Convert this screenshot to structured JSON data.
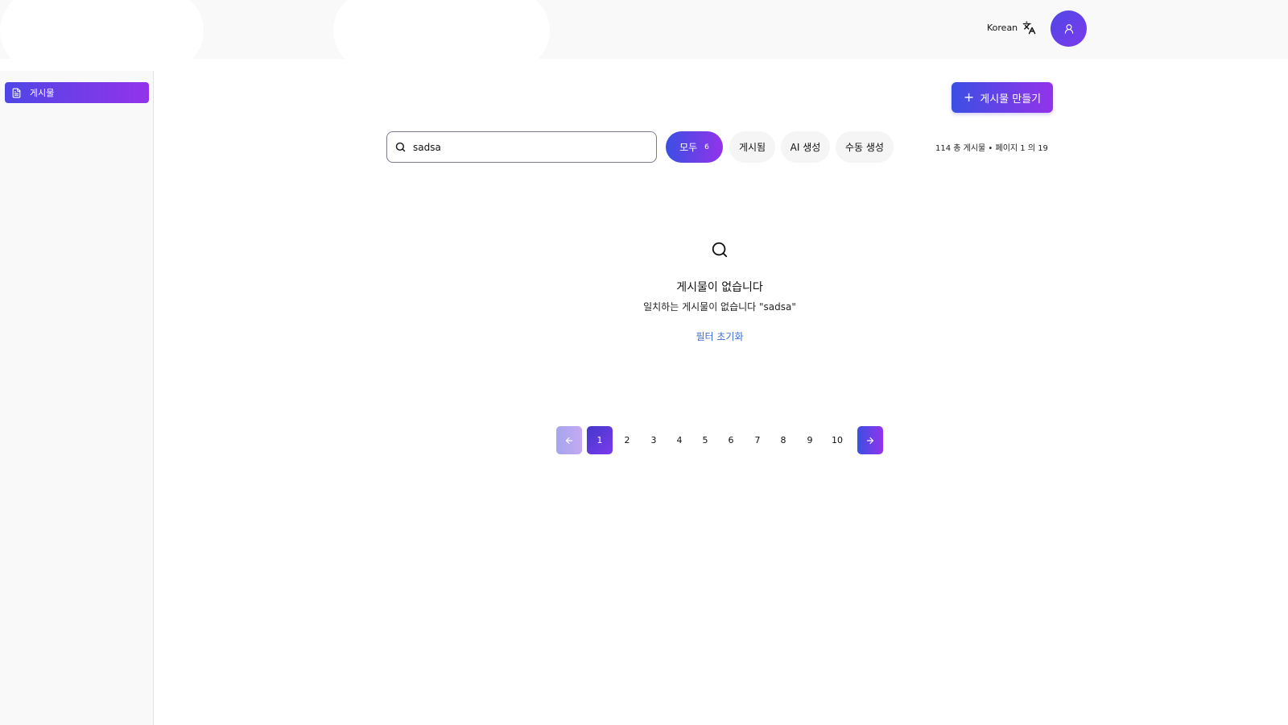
{
  "header": {
    "language_label": "Korean",
    "language_icon": "translate-icon",
    "avatar_icon": "user-icon"
  },
  "sidebar": {
    "items": [
      {
        "label": "게시물",
        "icon": "document-icon",
        "active": true
      }
    ]
  },
  "toolbar": {
    "create_label": "게시물 만들기"
  },
  "search": {
    "value": "sadsa",
    "icon": "search-icon"
  },
  "filters": [
    {
      "label": "모두",
      "count": "6",
      "selected": true
    },
    {
      "label": "게시됨",
      "selected": false
    },
    {
      "label": "AI 생성",
      "selected": false
    },
    {
      "label": "수동 생성",
      "selected": false
    }
  ],
  "summary": "114 총 게시물 • 페이지 1 의 19",
  "empty_state": {
    "icon": "search-icon",
    "title": "게시물이 없습니다",
    "message": "일치하는 게시물이 없습니다 \"sadsa\"",
    "reset_label": "필터 초기화"
  },
  "pagination": {
    "current": "1",
    "pages": [
      "2",
      "3",
      "4",
      "5",
      "6",
      "7",
      "8",
      "9",
      "10"
    ]
  },
  "colors": {
    "accent_start": "#3b4fe4",
    "accent_end": "#9333ea",
    "link": "#3b6fd8"
  }
}
